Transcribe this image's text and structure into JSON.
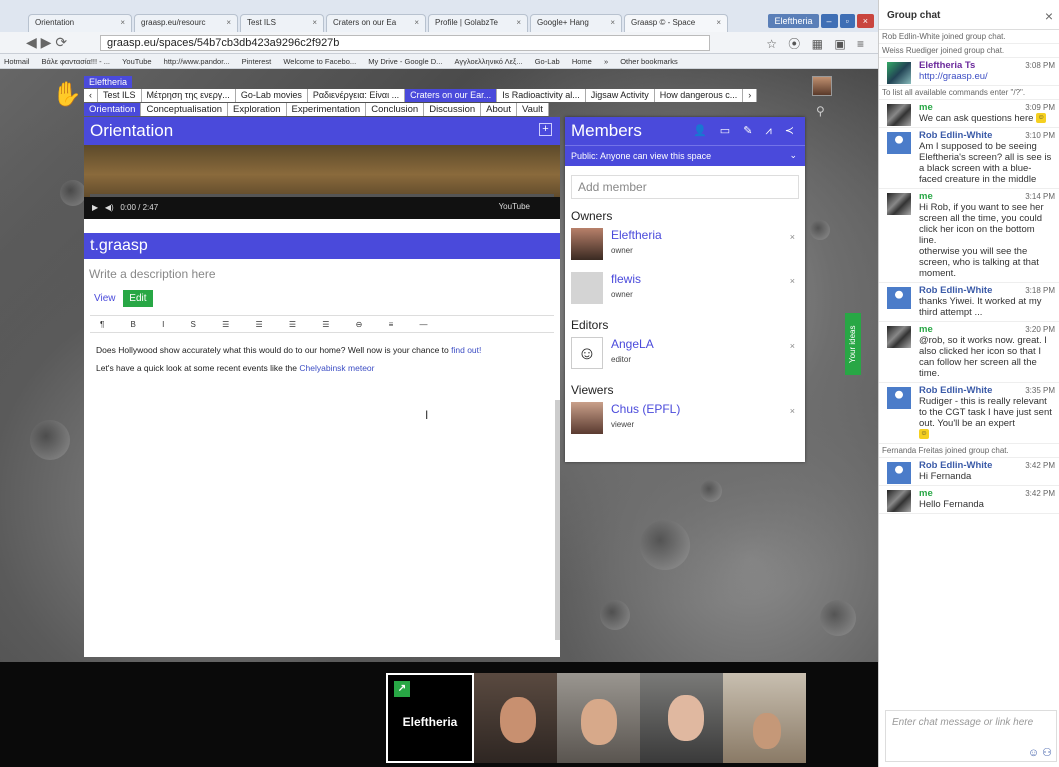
{
  "browser": {
    "tabs": [
      "Orientation",
      "graasp.eu/resourc",
      "Test ILS",
      "Craters on our Ea",
      "Profile | GolabzTe",
      "Google+ Hang",
      "Graasp © - Space"
    ],
    "user_badge": "Eleftheria",
    "url": "graasp.eu/spaces/54b7cb3db423a9296c2f927b",
    "bookmarks": [
      "Hotmail",
      "Βάλε φαντασία!!! - ...",
      "YouTube",
      "http://www.pandor...",
      "Pinterest",
      "Welcome to Facebo...",
      "My Drive - Google D...",
      "Αγγλοελληνικό Λεξ...",
      "Go-Lab",
      "Home",
      "»",
      "Other bookmarks"
    ]
  },
  "space": {
    "name": "Eleftheria",
    "subspaces": [
      "Test ILS",
      "Μέτρηση της ενεργ...",
      "Go-Lab movies",
      "Ραδιενέργεια: Είναι ...",
      "Craters on our Ear...",
      "Is Radioactivity al...",
      "Jigsaw Activity",
      "How dangerous c..."
    ],
    "phases": [
      "Orientation",
      "Conceptualisation",
      "Exploration",
      "Experimentation",
      "Conclusion",
      "Discussion",
      "About",
      "Vault"
    ]
  },
  "main": {
    "phase_title": "Orientation",
    "video_time": "0:00 / 2:47",
    "video_provider": "YouTube",
    "app_title": "t.graasp",
    "description_placeholder": "Write a description here",
    "view_label": "View",
    "edit_label": "Edit",
    "toolbar": "¶ B I S ☰ ☰ ☰ ☰ ⊖ ≡ —",
    "line1_text": "Does Hollywood show accurately what this would do to our home? Well now is your chance to ",
    "line1_link": "find out!",
    "line2_text": "Let's have a quick look at some recent events like the ",
    "line2_link": "Chelyabinsk meteor"
  },
  "members": {
    "title": "Members",
    "visibility": "Public: Anyone can view this space",
    "add_placeholder": "Add member",
    "groups": {
      "owners": "Owners",
      "editors": "Editors",
      "viewers": "Viewers"
    },
    "list": [
      {
        "name": "Eleftheria",
        "role": "owner"
      },
      {
        "name": "flewis",
        "role": "owner"
      },
      {
        "name": "AngeLA",
        "role": "editor"
      },
      {
        "name": "Chus (EPFL)",
        "role": "viewer"
      }
    ],
    "remove": "×"
  },
  "your_ideas": "Your ideas",
  "call": {
    "presenter": "Eleftheria"
  },
  "chat": {
    "title": "Group chat",
    "close": "×",
    "sys1": "Rob Edlin-White joined group chat.",
    "sys2": "Weiss Ruediger joined group chat.",
    "sys3": "To list all available commands enter \"/?\".",
    "sys4": "Fernanda Freitas joined group chat.",
    "messages": [
      {
        "who": "Eleftheria Ts",
        "time": "3:08 PM",
        "text": "http://graasp.eu/"
      },
      {
        "who": "me",
        "time": "3:09 PM",
        "text": "We can ask questions here"
      },
      {
        "who": "Rob Edlin-White",
        "time": "3:10 PM",
        "text": "Am I supposed to be seeing Eleftheria's screen? all is see is a black screen with a blue-faced creature in the middle"
      },
      {
        "who": "me",
        "time": "3:14 PM",
        "text": "Hi Rob, if you want to see her screen all the time, you could click her icon on the bottom line."
      },
      {
        "who": "",
        "time": "",
        "text": "otherwise you will see the screen, who is talking at that moment."
      },
      {
        "who": "Rob Edlin-White",
        "time": "3:18 PM",
        "text": "thanks Yiwei. It worked at my third attempt ..."
      },
      {
        "who": "me",
        "time": "3:20 PM",
        "text": "@rob, so it works now. great. I also clicked her icon so that I can follow her screen all the time."
      },
      {
        "who": "Rob Edlin-White",
        "time": "3:35 PM",
        "text": "Rudiger - this is really relevant to the CGT task I have just sent out. You'll be an expert"
      },
      {
        "who": "Rob Edlin-White",
        "time": "3:42 PM",
        "text": "Hi Fernanda"
      },
      {
        "who": "me",
        "time": "3:42 PM",
        "text": "Hello Fernanda"
      }
    ],
    "input_placeholder": "Enter chat message or link here"
  }
}
